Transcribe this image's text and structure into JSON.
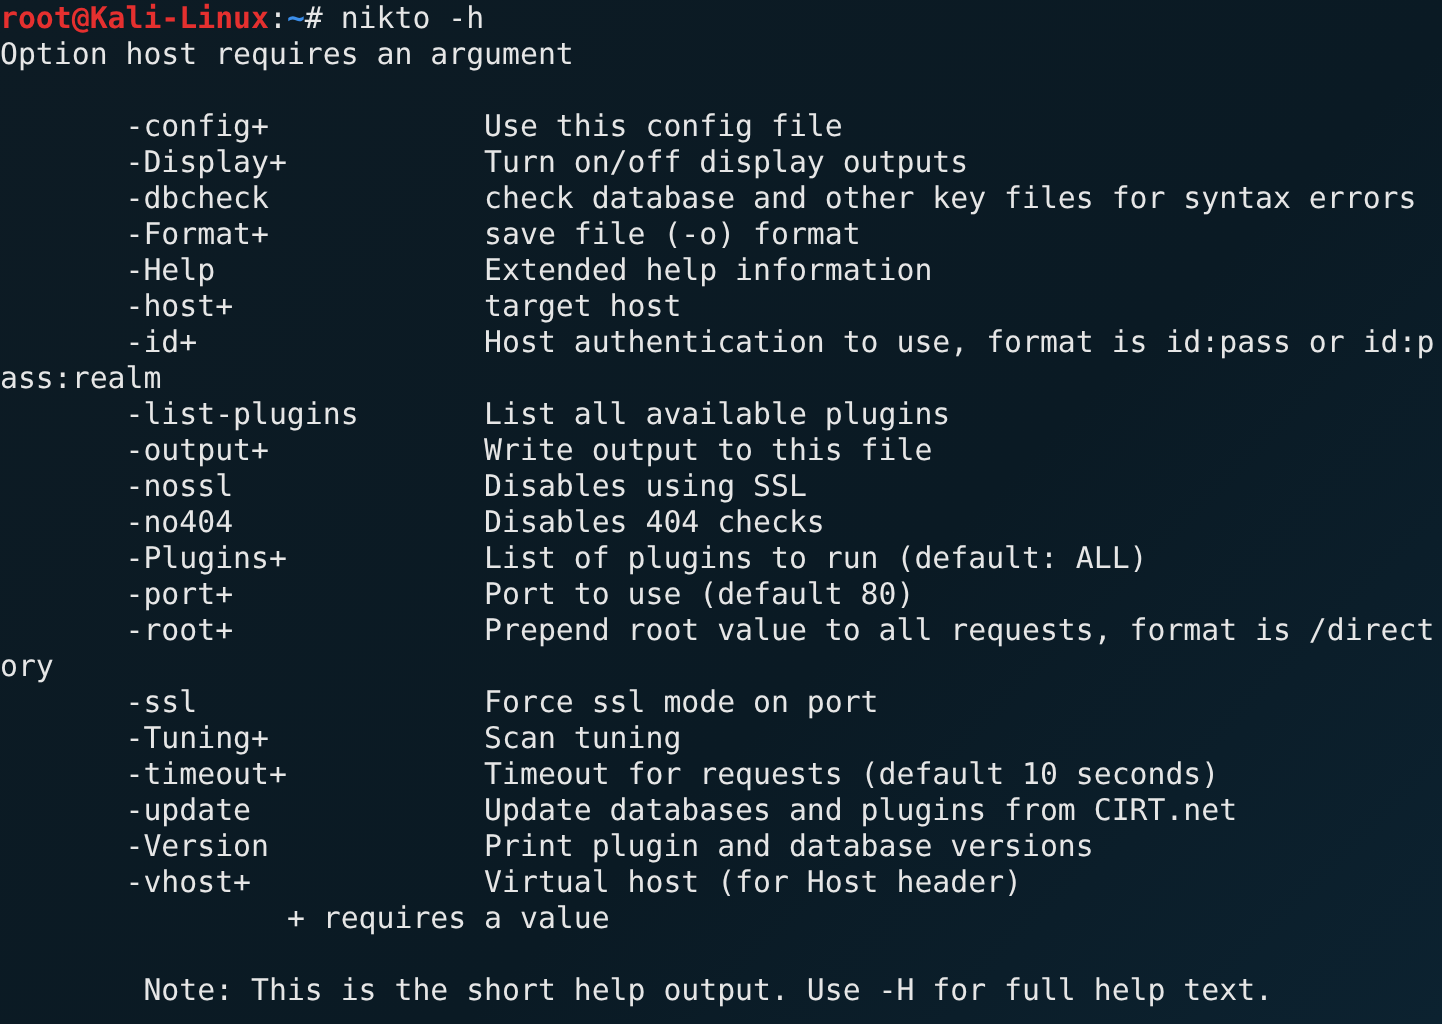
{
  "prompt": {
    "user_host": "root@Kali-Linux",
    "separator": ":",
    "path": "~",
    "symbol": "#",
    "command": "nikto -h"
  },
  "lines": [
    {
      "kind": "text",
      "text": "Option host requires an argument"
    },
    {
      "kind": "blank"
    },
    {
      "kind": "option",
      "flag": "-config+",
      "description": "Use this config file"
    },
    {
      "kind": "option",
      "flag": "-Display+",
      "description": "Turn on/off display outputs"
    },
    {
      "kind": "option",
      "flag": "-dbcheck",
      "description": "check database and other key files for syntax errors"
    },
    {
      "kind": "option",
      "flag": "-Format+",
      "description": "save file (-o) format"
    },
    {
      "kind": "option",
      "flag": "-Help",
      "description": "Extended help information"
    },
    {
      "kind": "option",
      "flag": "-host+",
      "description": "target host"
    },
    {
      "kind": "option",
      "flag": "-id+",
      "description": "Host authentication to use, format is id:pass or id:p"
    },
    {
      "kind": "text",
      "text": "ass:realm"
    },
    {
      "kind": "option",
      "flag": "-list-plugins",
      "description": "List all available plugins"
    },
    {
      "kind": "option",
      "flag": "-output+",
      "description": "Write output to this file"
    },
    {
      "kind": "option",
      "flag": "-nossl",
      "description": "Disables using SSL"
    },
    {
      "kind": "option",
      "flag": "-no404",
      "description": "Disables 404 checks"
    },
    {
      "kind": "option",
      "flag": "-Plugins+",
      "description": "List of plugins to run (default: ALL)"
    },
    {
      "kind": "option",
      "flag": "-port+",
      "description": "Port to use (default 80)"
    },
    {
      "kind": "option",
      "flag": "-root+",
      "description": "Prepend root value to all requests, format is /direct"
    },
    {
      "kind": "text",
      "text": "ory"
    },
    {
      "kind": "option",
      "flag": "-ssl",
      "description": "Force ssl mode on port"
    },
    {
      "kind": "option",
      "flag": "-Tuning+",
      "description": "Scan tuning"
    },
    {
      "kind": "option",
      "flag": "-timeout+",
      "description": "Timeout for requests (default 10 seconds)"
    },
    {
      "kind": "option",
      "flag": "-update",
      "description": "Update databases and plugins from CIRT.net"
    },
    {
      "kind": "option",
      "flag": "-Version",
      "description": "Print plugin and database versions"
    },
    {
      "kind": "option",
      "flag": "-vhost+",
      "description": "Virtual host (for Host header)"
    },
    {
      "kind": "footnote",
      "text": "+ requires a value"
    },
    {
      "kind": "blank"
    },
    {
      "kind": "note",
      "text": "Note: This is the short help output. Use -H for full help text."
    }
  ]
}
